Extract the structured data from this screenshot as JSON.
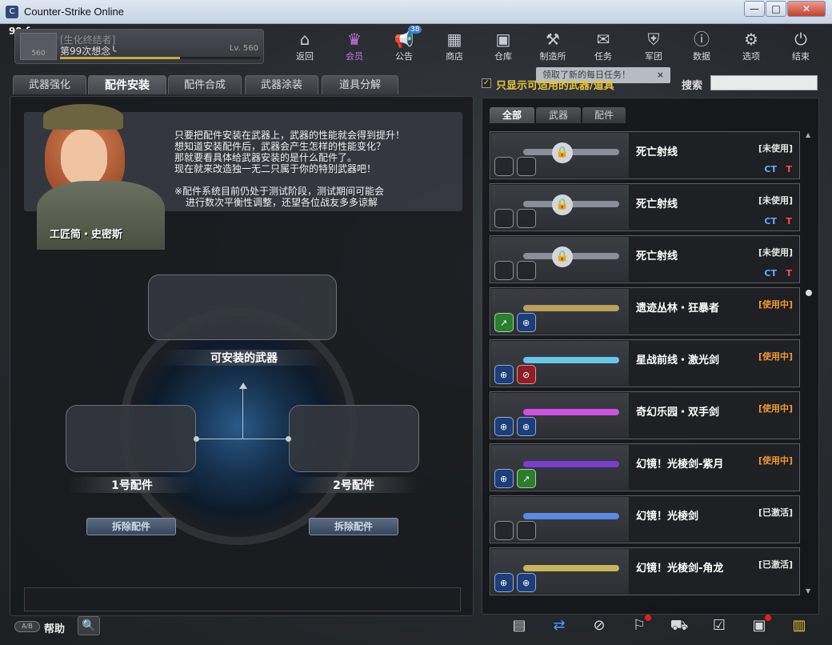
{
  "window": {
    "title": "Counter-Strike Online",
    "icon": "cs-logo-icon",
    "minimize": "—",
    "maximize": "□",
    "close": "✕"
  },
  "fps": "99 fps",
  "profile": {
    "clan": "[生化终结者]",
    "name": "第99次想念╰",
    "level": "Lv. 560",
    "rank_badge": "560",
    "xp_fraction": 0.6
  },
  "nav": [
    {
      "label": "返回",
      "icon": "home-icon",
      "glyph": "⌂"
    },
    {
      "label": "会员",
      "icon": "crown-icon",
      "glyph": "♛"
    },
    {
      "label": "公告",
      "icon": "megaphone-icon",
      "glyph": "📢",
      "badge": "38"
    },
    {
      "label": "商店",
      "icon": "shop-icon",
      "glyph": "▦"
    },
    {
      "label": "仓库",
      "icon": "inventory-icon",
      "glyph": "▣"
    },
    {
      "label": "制造所",
      "icon": "forge-icon",
      "glyph": "⚒"
    },
    {
      "label": "任务",
      "icon": "mission-icon",
      "glyph": "✉"
    },
    {
      "label": "军团",
      "icon": "clan-icon",
      "glyph": "⛨"
    },
    {
      "label": "数据",
      "icon": "info-icon",
      "glyph": "ⓘ"
    },
    {
      "label": "选项",
      "icon": "gear-icon",
      "glyph": "⚙"
    },
    {
      "label": "结束",
      "icon": "power-icon",
      "glyph": "⏻"
    }
  ],
  "daily_notice": {
    "text": "领取了新的每日任务！",
    "close": "×"
  },
  "tabs": [
    "武器强化",
    "配件安装",
    "配件合成",
    "武器涂装",
    "道具分解"
  ],
  "active_tab": 1,
  "npc": {
    "name": "工匠简・史密斯",
    "lines": [
      "只要把配件安装在武器上，武器的性能就会得到提升！",
      "想知道安装配件后，武器会产生怎样的性能变化？",
      "那就要看具体给武器安装的是什么配件了。",
      "现在就来改造独一无二只属于你的特别武器吧！",
      "※配件系统目前仍处于测试阶段，测试期间可能会",
      "进行数次平衡性调整，还望各位战友多多谅解"
    ]
  },
  "assembly": {
    "weapon_slot": "可安装的武器",
    "slot1": "1号配件",
    "slot2": "2号配件",
    "remove_btn": "拆除配件"
  },
  "filter": {
    "checked": true,
    "label": "只显示可适用的武器/道具",
    "search_label": "搜索",
    "search_value": ""
  },
  "subtabs": [
    "全部",
    "武器",
    "配件"
  ],
  "items": [
    {
      "name": "死亡射线",
      "status": "[未使用]",
      "using": false,
      "locked": true,
      "ct": "CT",
      "t": "T",
      "slots": [
        "empty",
        "empty"
      ],
      "gun_color": "#8a9099"
    },
    {
      "name": "死亡射线",
      "status": "[未使用]",
      "using": false,
      "locked": true,
      "ct": "CT",
      "t": "T",
      "slots": [
        "empty",
        "empty"
      ],
      "gun_color": "#8a9099"
    },
    {
      "name": "死亡射线",
      "status": "[未使用]",
      "using": false,
      "locked": true,
      "ct": "CT",
      "t": "T",
      "slots": [
        "empty",
        "empty"
      ],
      "gun_color": "#8a9099"
    },
    {
      "name": "遗迹丛林・狂暴者",
      "status": "[使用中]",
      "using": true,
      "locked": false,
      "slots": [
        "green",
        "filled"
      ],
      "gun_color": "#b8a15a"
    },
    {
      "name": "星战前线・激光剑",
      "status": "[使用中]",
      "using": true,
      "locked": false,
      "slots": [
        "filled",
        "red"
      ],
      "gun_color": "#67c6e8"
    },
    {
      "name": "奇幻乐园・双手剑",
      "status": "[使用中]",
      "using": true,
      "locked": false,
      "slots": [
        "filled",
        "filled"
      ],
      "gun_color": "#d052e2"
    },
    {
      "name": "幻镜！光棱剑-紫月",
      "status": "[使用中]",
      "using": true,
      "locked": false,
      "slots": [
        "filled",
        "green"
      ],
      "gun_color": "#7a3fd0"
    },
    {
      "name": "幻镜！光棱剑",
      "status": "[已激活]",
      "using": false,
      "locked": false,
      "slots": [
        "empty",
        "empty"
      ],
      "gun_color": "#5b8ae0"
    },
    {
      "name": "幻镜！光棱剑-角龙",
      "status": "[已激活]",
      "using": false,
      "locked": false,
      "slots": [
        "filled",
        "filled"
      ],
      "gun_color": "#c9b45a"
    }
  ],
  "footer": {
    "help_toggle": "A/B",
    "help_label": "帮助",
    "zoom": "🔍",
    "icons": [
      "list-icon",
      "sync-icon",
      "compass-icon",
      "run-icon",
      "cart-icon",
      "checklist-icon",
      "calendar-check-icon",
      "film-icon"
    ]
  }
}
